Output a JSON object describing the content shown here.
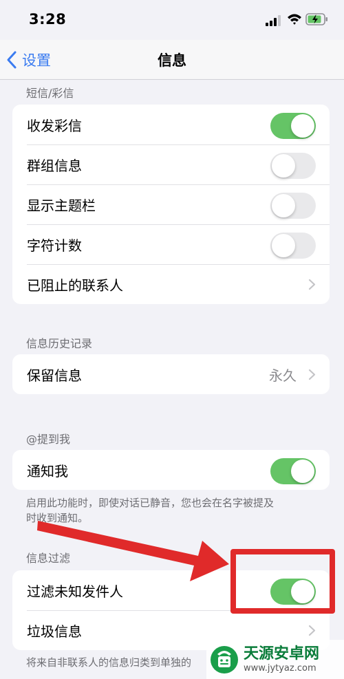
{
  "status_bar": {
    "time": "3:28"
  },
  "nav": {
    "back_label": "设置",
    "title": "信息"
  },
  "sections": {
    "sms": {
      "header": "短信/彩信",
      "items": [
        {
          "label": "收发彩信",
          "toggle": true
        },
        {
          "label": "群组信息",
          "toggle": false
        },
        {
          "label": "显示主题栏",
          "toggle": false
        },
        {
          "label": "字符计数",
          "toggle": false
        },
        {
          "label": "已阻止的联系人"
        }
      ]
    },
    "history": {
      "header": "信息历史记录",
      "items": [
        {
          "label": "保留信息",
          "value": "永久"
        }
      ]
    },
    "mentions": {
      "header": "@提到我",
      "items": [
        {
          "label": "通知我",
          "toggle": true
        }
      ],
      "footer_line1": "启用此功能时，即使对话已静音，您也会在名字被提及",
      "footer_line2": "时收到通知。"
    },
    "filter": {
      "header": "信息过滤",
      "items": [
        {
          "label": "过滤未知发件人",
          "toggle": true
        },
        {
          "label": "垃圾信息"
        }
      ],
      "footer": "将来自非联系人的信息归类到单独的"
    }
  },
  "watermark": {
    "title": "天源安卓网",
    "url": "www.jytyaz.com"
  },
  "colors": {
    "accent": "#3a7bf0",
    "toggle_on": "#65c466",
    "annotation": "#e02a2a"
  }
}
